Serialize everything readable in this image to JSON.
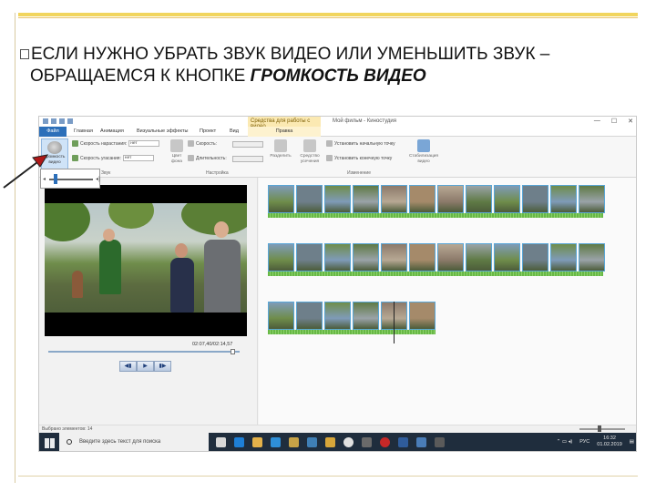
{
  "slide": {
    "line1": "ЕСЛИ НУЖНО УБРАТЬ ЗВУК ВИДЕО ИЛИ УМЕНЬШИТЬ ЗВУК –",
    "line2_plain": "ОБРАЩАЕМСЯ К  КНОПКЕ ",
    "line2_emph": "ГРОМКОСТЬ ВИДЕО"
  },
  "window": {
    "context_tab_header": "Средства для работы с видео",
    "title": "Мой фильм - Киностудия",
    "win_buttons": [
      "—",
      "☐",
      "✕"
    ]
  },
  "tabs": [
    "Файл",
    "Главная",
    "Анимация",
    "Визуальные эффекты",
    "Проект",
    "Вид",
    "Правка"
  ],
  "ribbon": {
    "volume_button_label": "Громкость видео",
    "fade_in_label": "Скорость нарастания:",
    "fade_in_value": "нет",
    "fade_out_label": "Скорость угасания:",
    "fade_out_value": "нет",
    "bg_color_label": "Цвет фона",
    "speed_label": "Скорость:",
    "duration_label": "Длительность:",
    "split_label": "Разделить",
    "trim_label": "Средство усечения",
    "set_start_label": "Установить начальную точку",
    "set_end_label": "Установить конечную точку",
    "stabilize_label": "Стабилизация видео",
    "group_audio": "Звук",
    "group_settings": "Настройка",
    "group_edit": "Изменение"
  },
  "preview": {
    "timecode": "02:07,40/02:14,57",
    "buttons": [
      "◀▮",
      "▶",
      "▮▶"
    ]
  },
  "status": {
    "selected": "Выбрано элементов: 14"
  },
  "taskbar": {
    "search_placeholder": "Введите здесь текст для поиска",
    "lang": "РУС",
    "time": "16:32",
    "date": "01.02.2019"
  },
  "colors": {
    "accent": "#2c6fb9",
    "context_tab": "#fbe9b2",
    "frame_border": "#59a6d6",
    "audio_wave": "#67b845",
    "taskbar": "#1f2d3d",
    "arrow": "#b01818"
  }
}
